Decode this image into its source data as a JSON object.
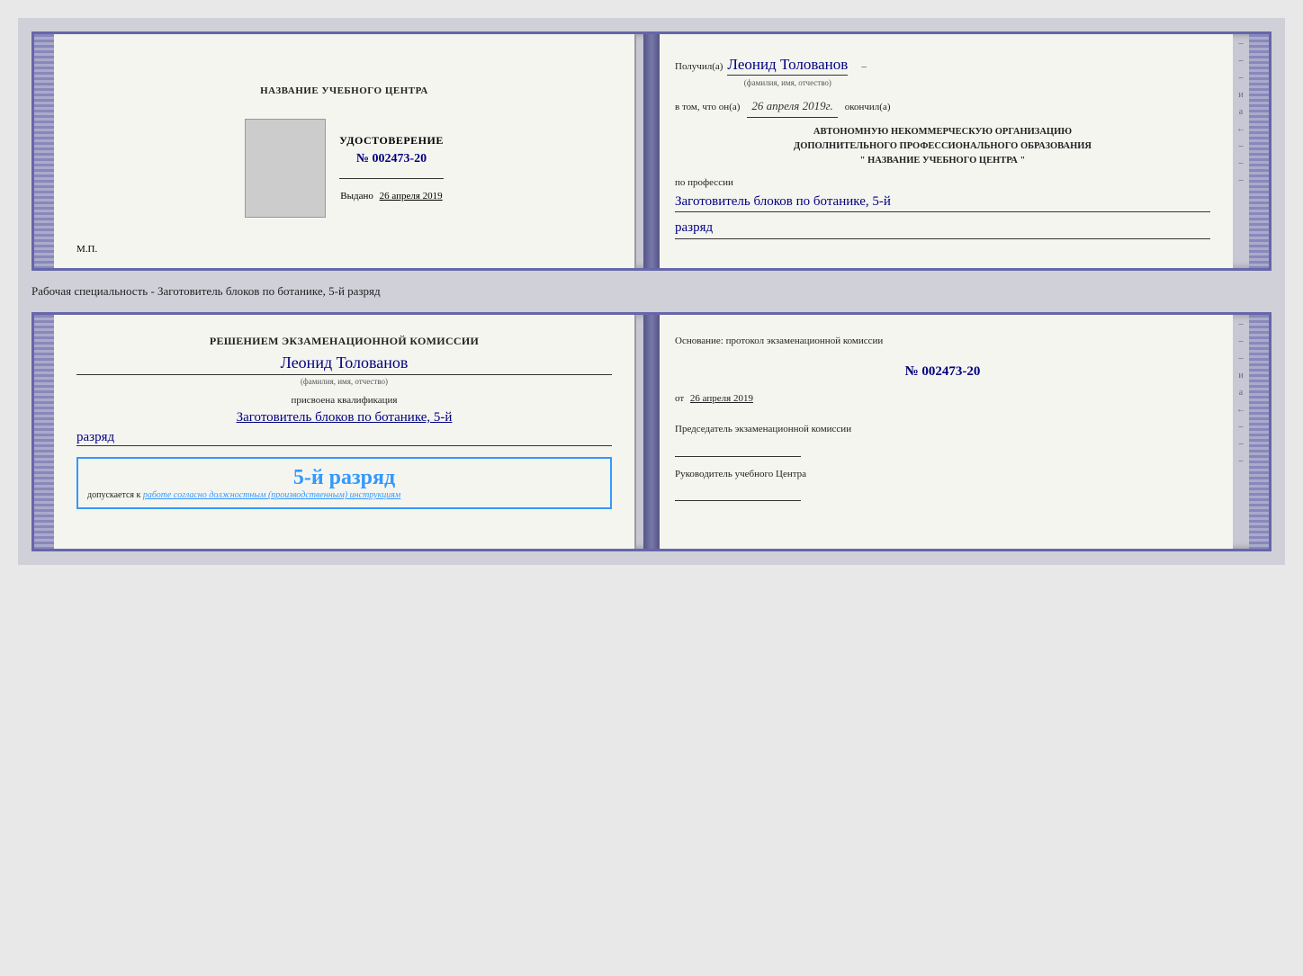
{
  "page": {
    "background": "#d4d4dc"
  },
  "top_book": {
    "left": {
      "org_name": "НАЗВАНИЕ УЧЕБНОГО ЦЕНТРА",
      "cert_title": "УДОСТОВЕРЕНИЕ",
      "cert_number": "№ 002473-20",
      "issued_label": "Выдано",
      "issued_date": "26 апреля 2019",
      "mp_label": "М.П."
    },
    "right": {
      "recipient_prefix": "Получил(а)",
      "recipient_name": "Леонид Толованов",
      "name_subtitle": "(фамилия, имя, отчество)",
      "date_prefix": "в том, что он(а)",
      "date_value": "26 апреля 2019г.",
      "date_suffix": "окончил(а)",
      "org_line1": "АВТОНОМНУЮ НЕКОММЕРЧЕСКУЮ ОРГАНИЗАЦИЮ",
      "org_line2": "ДОПОЛНИТЕЛЬНОГО ПРОФЕССИОНАЛЬНОГО ОБРАЗОВАНИЯ",
      "org_line3": "\" НАЗВАНИЕ УЧЕБНОГО ЦЕНТРА \"",
      "profession_label": "по профессии",
      "profession_value": "Заготовитель блоков по ботанике, 5-й",
      "rank_value": "разряд"
    }
  },
  "specialty_text": "Рабочая специальность - Заготовитель блоков по ботанике, 5-й разряд",
  "bottom_book": {
    "left": {
      "commission_intro": "Решением экзаменационной комиссии",
      "person_name": "Леонид Толованов",
      "name_subtitle": "(фамилия, имя, отчество)",
      "qualification_text": "присвоена квалификация",
      "profession_value": "Заготовитель блоков по ботанике, 5-й",
      "rank_value": "разряд",
      "stamp_rank": "5-й разряд",
      "stamp_admission_prefix": "допускается к",
      "stamp_admission_italic": "работе согласно должностным (производственным) инструкциям"
    },
    "right": {
      "basis_label": "Основание: протокол экзаменационной комиссии",
      "protocol_number": "№  002473-20",
      "date_prefix": "от",
      "date_value": "26 апреля 2019",
      "chairman_label": "Председатель экзаменационной комиссии",
      "director_label": "Руководитель учебного Центра"
    }
  },
  "side_dashes": [
    "–",
    "–",
    "–",
    "и",
    "а",
    "←",
    "–",
    "–",
    "–"
  ]
}
